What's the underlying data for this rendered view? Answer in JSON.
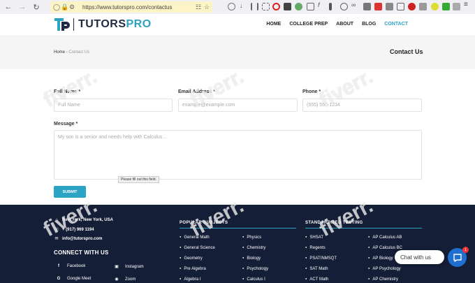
{
  "browser": {
    "url": "https://www.tutorspro.com/contactus",
    "back_icon": "back-arrow-icon",
    "reload_icon": "reload-icon"
  },
  "header": {
    "logo_text_main": "TUTORS",
    "logo_text_accent": "PRO",
    "nav": [
      "HOME",
      "COLLEGE PREP",
      "ABOUT",
      "BLOG",
      "CONTACT"
    ],
    "active_nav": "CONTACT"
  },
  "breadcrumb": {
    "home": "Home",
    "sep": " - ",
    "current": "Contact Us"
  },
  "page_title": "Contact Us",
  "form": {
    "full_name_label": "Full Name *",
    "full_name_placeholder": "Full Name",
    "email_label": "Email Address *",
    "email_placeholder": "example@example.com",
    "phone_label": "Phone *",
    "phone_placeholder": "(555) 555-1234",
    "message_label": "Message *",
    "message_placeholder": "My son is a senior and needs help with Calculus...",
    "validation_tooltip": "Please fill out this field.",
    "submit_label": "SUBMIT"
  },
  "footer": {
    "address": "New York, New York, USA",
    "phone": "+ (917) 969 1194",
    "email": "info@tutorspro.com",
    "connect_title": "CONNECT WITH US",
    "social": [
      "Facebook",
      "Instagram",
      "Google Meet",
      "Zoom"
    ],
    "popular_title": "POPULAR SUBJECTS",
    "popular_col1": [
      "General Math",
      "General Science",
      "Geometry",
      "Pre Algebra",
      "Algebra I"
    ],
    "popular_col2": [
      "Physics",
      "Chemistry",
      "Biology",
      "Psychology",
      "Calculus I"
    ],
    "testing_title": "STANDARDIZED TESTING",
    "testing_col1": [
      "SHSAT",
      "Regents",
      "PSAT/NMSQT",
      "SAT Math",
      "ACT Math"
    ],
    "testing_col2": [
      "AP Calculus AB",
      "AP Calculus BC",
      "AP Biology",
      "AP Psychology",
      "AP Chemistry"
    ]
  },
  "chat": {
    "label": "Chat with us",
    "badge": "1"
  },
  "watermark": "fiverr.",
  "colors": {
    "accent": "#2ba3c4",
    "navy": "#141e36",
    "chat_blue": "#1f6fd1"
  }
}
